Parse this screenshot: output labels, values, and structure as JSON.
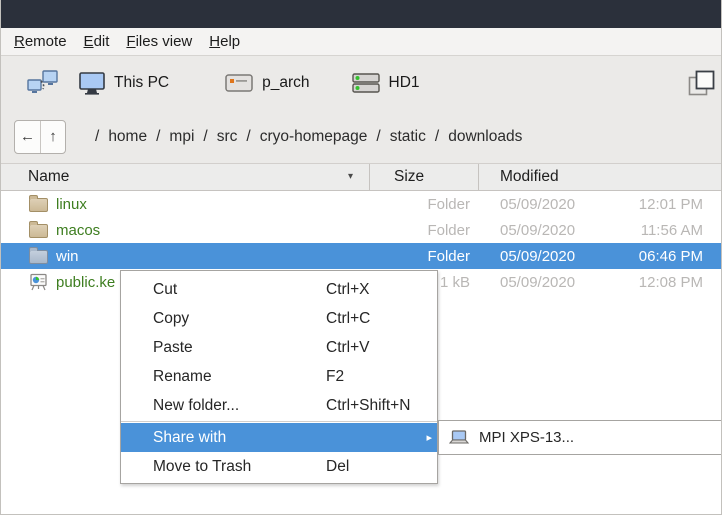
{
  "menubar": {
    "items": [
      {
        "label": "Remote"
      },
      {
        "label": "Edit"
      },
      {
        "label": "Files view"
      },
      {
        "label": "Help"
      }
    ]
  },
  "toolbar": {
    "this_pc_label": "This PC",
    "p_arch_label": "p_arch",
    "hd1_label": "HD1"
  },
  "navbar": {
    "back_glyph": "←",
    "up_glyph": "↑",
    "separator": "/",
    "path_segments": [
      "home",
      "mpi",
      "src",
      "cryo-homepage",
      "static",
      "downloads"
    ]
  },
  "file_list": {
    "columns": {
      "name": "Name",
      "size": "Size",
      "modified": "Modified"
    },
    "sort_glyph": "▾",
    "rows": [
      {
        "name": "linux",
        "size": "Folder",
        "date": "05/09/2020",
        "time": "12:01 PM",
        "selected": false
      },
      {
        "name": "macos",
        "size": "Folder",
        "date": "05/09/2020",
        "time": "11:56 AM",
        "selected": false
      },
      {
        "name": "win",
        "size": "Folder",
        "date": "05/09/2020",
        "time": "06:46 PM",
        "selected": true
      },
      {
        "name": "public.ke",
        "size": "1 kB",
        "date": "05/09/2020",
        "time": "12:08 PM",
        "selected": false
      }
    ]
  },
  "context_menu": {
    "items": [
      {
        "label": "Cut",
        "shortcut": "Ctrl+X"
      },
      {
        "label": "Copy",
        "shortcut": "Ctrl+C"
      },
      {
        "label": "Paste",
        "shortcut": "Ctrl+V"
      },
      {
        "label": "Rename",
        "shortcut": "F2"
      },
      {
        "label": "New folder...",
        "shortcut": "Ctrl+Shift+N"
      },
      {
        "label": "Share with",
        "shortcut": "",
        "submenu_arrow": "▸"
      },
      {
        "label": "Move to Trash",
        "shortcut": "Del"
      }
    ]
  },
  "submenu": {
    "items": [
      {
        "label": "MPI XPS-13..."
      }
    ]
  },
  "colors": {
    "selection_blue": "#4a92d9",
    "folder_name_green": "#3e7e20",
    "titlebar_dark": "#2b303b",
    "muted_value_gray": "#b9b7b5"
  }
}
